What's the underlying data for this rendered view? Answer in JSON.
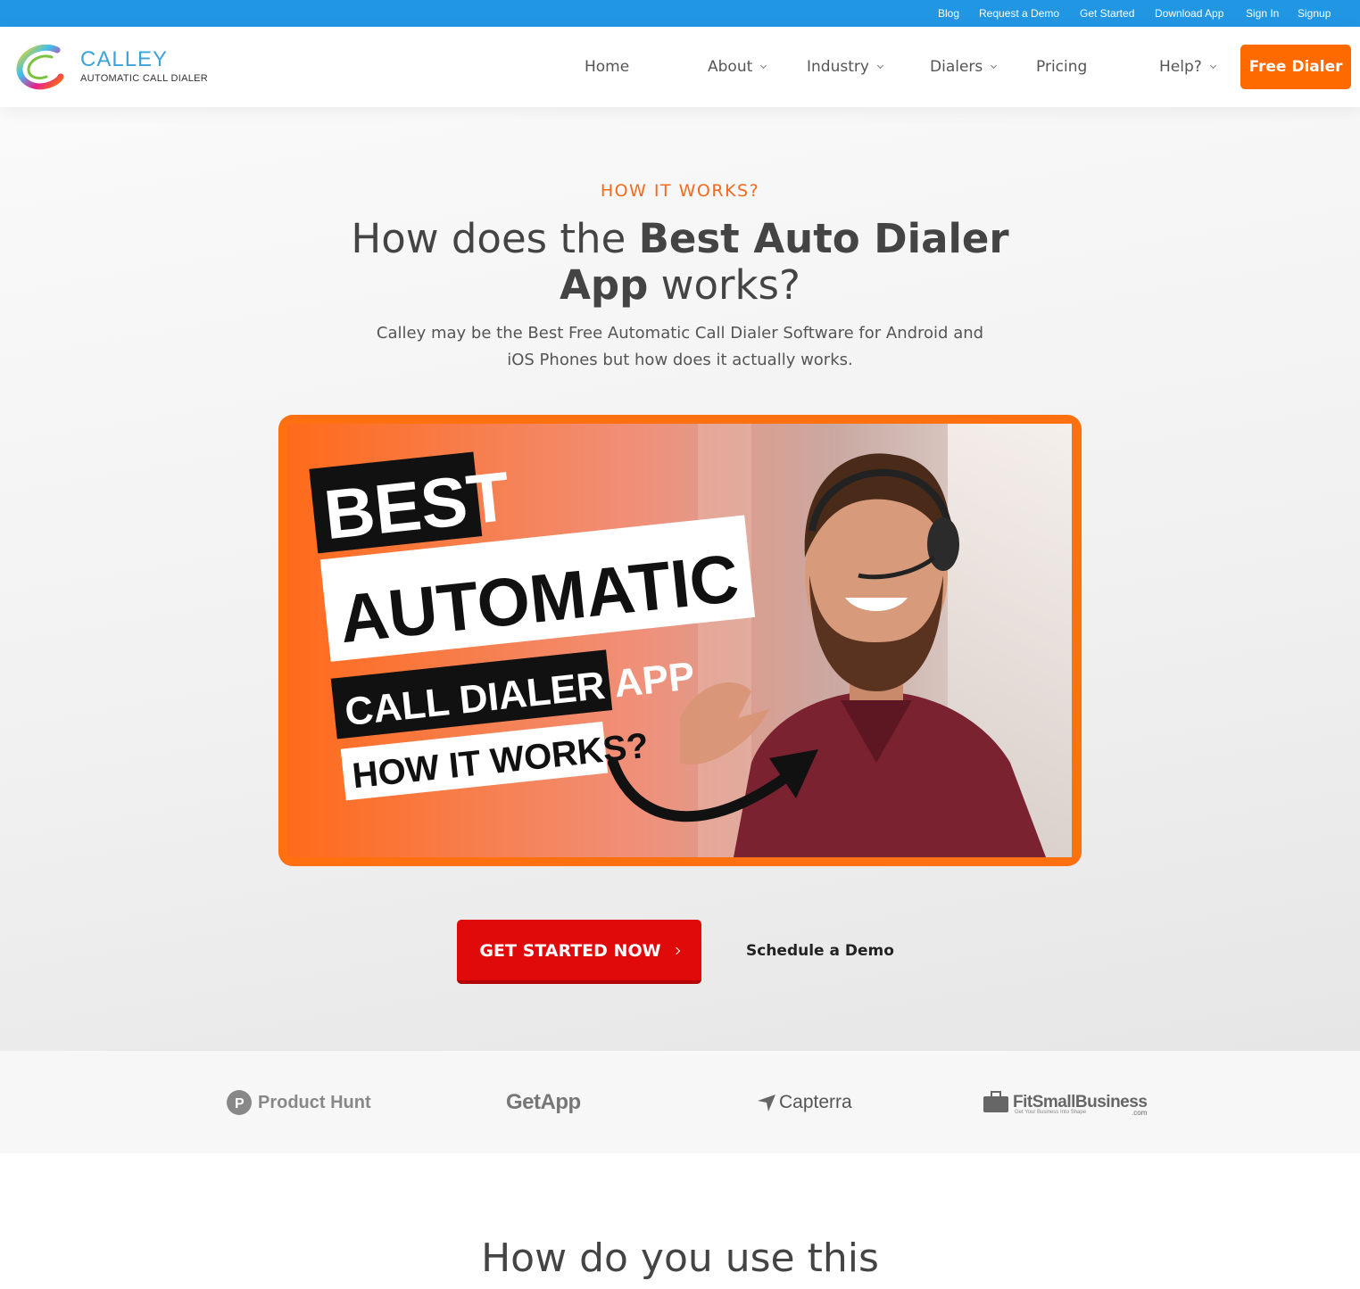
{
  "topbar": {
    "links": [
      "Blog",
      "Request a Demo",
      "Get Started",
      "Download App",
      "Sign In",
      "Signup"
    ]
  },
  "logo": {
    "name": "CALLEY",
    "tagline": "AUTOMATIC CALL DIALER"
  },
  "nav": {
    "items": [
      "Home",
      "About",
      "Industry",
      "Dialers",
      "Pricing",
      "Help?"
    ],
    "cta": "Free Dialer"
  },
  "hero": {
    "eyebrow": "HOW IT WORKS?",
    "headline_pre": "How does the ",
    "headline_bold": "Best Auto Dialer App",
    "headline_post": " works?",
    "subtext": "Calley may be the Best Free Automatic Call Dialer Software for Android and iOS Phones but how does it actually works.",
    "thumbnail": {
      "line1": "BEST",
      "line2": "AUTOMATIC",
      "line3": "CALL DIALER APP",
      "line4": "HOW IT WORKS?"
    },
    "cta_primary": "GET STARTED NOW",
    "cta_secondary": "Schedule a Demo"
  },
  "logos": {
    "items": [
      "Product Hunt",
      "GetApp",
      "Capterra",
      "FitSmallBusiness",
      "Get Your Business Into Shape",
      ".com"
    ]
  },
  "section2": {
    "title": "How do you use this"
  },
  "colors": {
    "topbar": "#2196e3",
    "accent_orange": "#ff6a00",
    "cta_red": "#e10a0a"
  }
}
